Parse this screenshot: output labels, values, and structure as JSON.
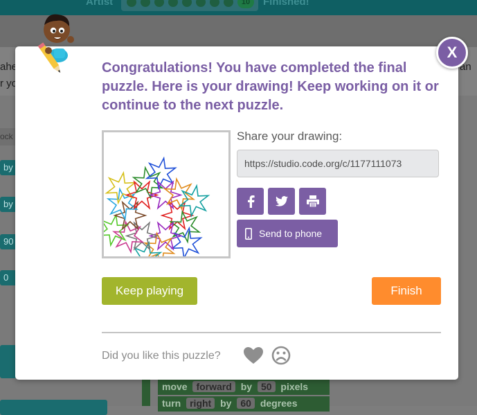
{
  "background": {
    "header_left_label": "Artist",
    "header_right_label": "Finished!",
    "current_puzzle": "10",
    "instructions_left": [
      "ahe",
      "r yo"
    ],
    "instructions_right": "an",
    "toolbox_label": "ock",
    "toolbox_blocks": [
      "by",
      "by",
      "90",
      "0",
      "0"
    ],
    "workspace_block_1": {
      "verb": "move",
      "dir": "forward",
      "by": "by",
      "val": "50",
      "unit": "pixels"
    },
    "workspace_block_2": {
      "verb": "turn",
      "dir": "right",
      "by": "by",
      "val": "60",
      "unit": "degrees"
    }
  },
  "dialog": {
    "close_label": "X",
    "headline": "Congratulations! You have completed the final puzzle. Here is your drawing! Keep working on it or continue to the next puzzle.",
    "share_title": "Share your drawing:",
    "share_url": "https://studio.code.org/c/1177111073",
    "share_buttons": [
      "facebook-icon",
      "twitter-icon",
      "print-icon"
    ],
    "send_to_phone_label": "Send to phone",
    "keep_playing_label": "Keep playing",
    "finish_label": "Finish",
    "feedback_question": "Did you like this puzzle?"
  },
  "colors": {
    "accent_purple": "#7b5ea4",
    "keep_playing_green": "#a2b52d",
    "finish_orange": "#ff8c2d",
    "headline_purple": "#7a5ea4"
  }
}
